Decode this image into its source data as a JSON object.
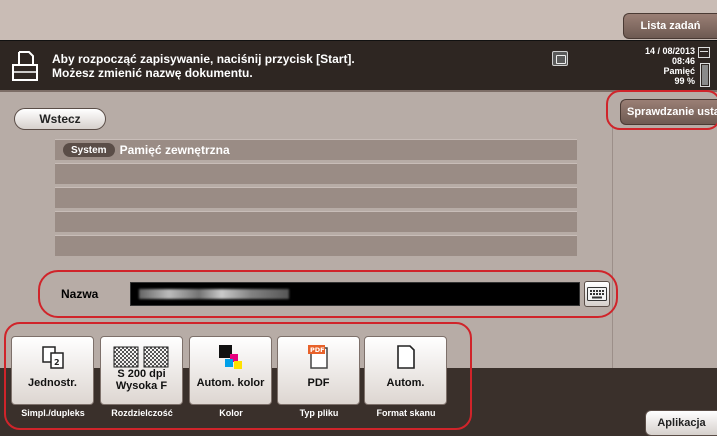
{
  "header": {
    "task_list_label": "Lista zadań",
    "message_line1": "Aby rozpocząć zapisywanie, naciśnij przycisk [Start].",
    "message_line2": "Możesz zmienić nazwę dokumentu.",
    "date": "14 / 08/2013",
    "time": "08:46",
    "memory_label": "Pamięć",
    "memory_value": "99 %",
    "memory_level": 0.99,
    "icons": [
      "document-icon",
      "status-icon",
      "calendar-icon"
    ]
  },
  "nav": {
    "back_label": "Wstecz",
    "check_settings_label": "Sprawdzanie ustawień"
  },
  "path": {
    "system_chip": "System",
    "current_folder": "Pamięć zewnętrzna"
  },
  "name_field": {
    "label": "Nazwa"
  },
  "settings": [
    {
      "value": "Jednostr.",
      "caption": "Simpl./dupleks",
      "icon": "simplex-icon"
    },
    {
      "value": "S 200 dpi Wysoka F",
      "caption": "Rozdzielczość",
      "icon": "resolution-icon"
    },
    {
      "value": "Autom. kolor",
      "caption": "Kolor",
      "icon": "color-icon"
    },
    {
      "value": "PDF",
      "caption": "Typ pliku",
      "icon": "pdf-icon"
    },
    {
      "value": "Autom.",
      "caption": "Format skanu",
      "icon": "page-size-icon"
    }
  ],
  "footer": {
    "application_label": "Aplikacja"
  },
  "colors": {
    "message_bar": "#2e2622",
    "list_row": "#9a8c85",
    "highlight": "#d0242a"
  }
}
